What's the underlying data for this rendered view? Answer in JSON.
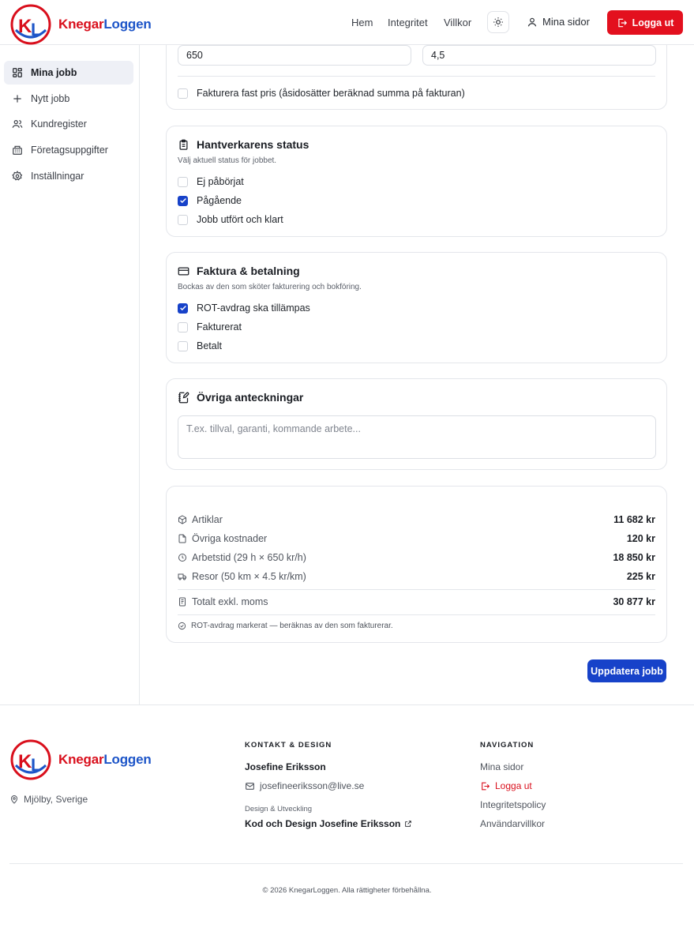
{
  "brand": {
    "name_part1": "Knegar",
    "name_part2": "Loggen",
    "logo_letters": "KL"
  },
  "header": {
    "nav": [
      "Hem",
      "Integritet",
      "Villkor"
    ],
    "theme_icon": "sun-icon",
    "mina_sidor": "Mina sidor",
    "logout": "Logga ut"
  },
  "sidebar": {
    "items": [
      {
        "label": "Mina jobb",
        "icon": "dashboard-icon",
        "active": true
      },
      {
        "label": "Nytt jobb",
        "icon": "plus-icon",
        "active": false
      },
      {
        "label": "Kundregister",
        "icon": "users-icon",
        "active": false
      },
      {
        "label": "Företagsuppgifter",
        "icon": "building-icon",
        "active": false
      },
      {
        "label": "Inställningar",
        "icon": "gear-icon",
        "active": false
      }
    ]
  },
  "pricing": {
    "hourly_rate_value": "650",
    "mileage_rate_value": "4,5",
    "fixed_price_label": "Fakturera fast pris (åsidosätter beräknad summa på fakturan)",
    "fixed_price_checked": false
  },
  "status": {
    "title": "Hantverkarens status",
    "subtitle": "Välj aktuell status för jobbet.",
    "options": [
      {
        "label": "Ej påbörjat",
        "checked": false
      },
      {
        "label": "Pågående",
        "checked": true
      },
      {
        "label": "Jobb utfört och klart",
        "checked": false
      }
    ]
  },
  "invoice": {
    "title": "Faktura & betalning",
    "subtitle": "Bockas av den som sköter fakturering och bokföring.",
    "options": [
      {
        "label": "ROT-avdrag ska tillämpas",
        "checked": true
      },
      {
        "label": "Fakturerat",
        "checked": false
      },
      {
        "label": "Betalt",
        "checked": false
      }
    ]
  },
  "notes": {
    "title": "Övriga anteckningar",
    "placeholder": "T.ex. tillval, garanti, kommande arbete..."
  },
  "summary": {
    "rows": [
      {
        "label": "Artiklar",
        "value": "11 682 kr",
        "icon": "box-icon"
      },
      {
        "label": "Övriga kostnader",
        "value": "120 kr",
        "icon": "file-icon"
      },
      {
        "label": "Arbetstid (29 h × 650 kr/h)",
        "value": "18 850 kr",
        "icon": "clock-icon"
      },
      {
        "label": "Resor (50 km × 4.5 kr/km)",
        "value": "225 kr",
        "icon": "truck-icon"
      }
    ],
    "total_label": "Totalt exkl. moms",
    "total_value": "30 877 kr",
    "rot_note": "ROT-avdrag markerat — beräknas av den som fakturerar."
  },
  "actions": {
    "update": "Uppdatera jobb"
  },
  "footer": {
    "location": "Mjölby, Sverige",
    "contact_heading": "KONTAKT & DESIGN",
    "contact_name": "Josefine Eriksson",
    "contact_email": "josefineeriksson@live.se",
    "design_small": "Design & Utveckling",
    "design_link": "Kod och Design Josefine Eriksson",
    "nav_heading": "NAVIGATION",
    "nav_links": [
      "Mina sidor",
      "Logga ut",
      "Integritetspolicy",
      "Användarvillkor"
    ],
    "copyright": "© 2026 KnegarLoggen. Alla rättigheter förbehållna."
  },
  "colors": {
    "brand_red": "#d90f1c",
    "brand_blue": "#1d55c8",
    "primary": "#1742c9",
    "danger": "#e3101e"
  }
}
